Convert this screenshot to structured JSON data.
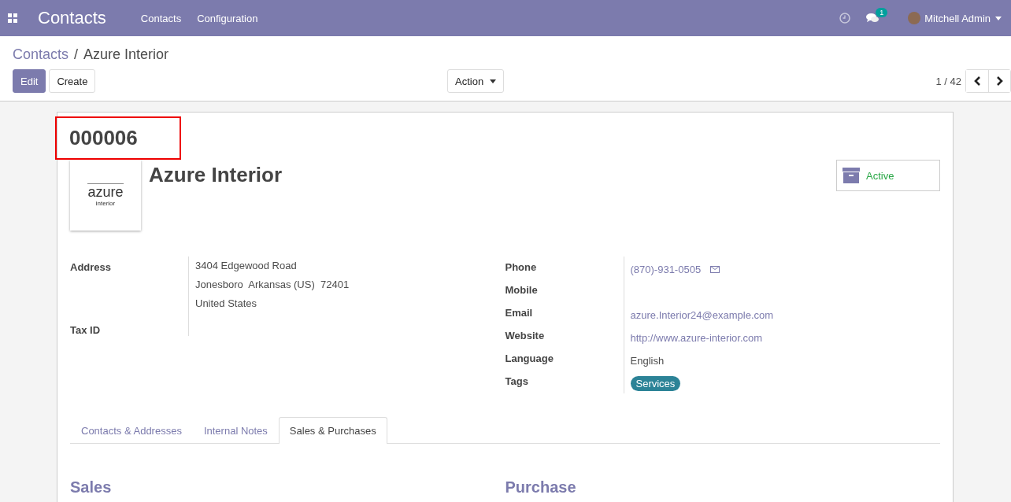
{
  "navbar": {
    "app_title": "Contacts",
    "menu": [
      "Contacts",
      "Configuration"
    ],
    "message_count": "1",
    "user": "Mitchell Admin"
  },
  "breadcrumb": {
    "parent": "Contacts",
    "separator": "/",
    "current": "Azure Interior"
  },
  "buttons": {
    "edit": "Edit",
    "create": "Create",
    "action": "Action"
  },
  "pager": "1 / 42",
  "record": {
    "reference": "000006",
    "name": "Azure Interior",
    "logo": {
      "top": "azure",
      "bottom": "interior"
    },
    "status": "Active"
  },
  "left_fields": [
    {
      "label": "Address",
      "lines": [
        "3404 Edgewood Road",
        "Jonesboro  Arkansas (US)  72401",
        "United States"
      ]
    },
    {
      "label": "Tax ID"
    }
  ],
  "right_fields": [
    {
      "label": "Phone",
      "value": "(870)-931-0505",
      "kind": "phone"
    },
    {
      "label": "Mobile",
      "kind": "text"
    },
    {
      "label": "Email",
      "value": "azure.Interior24@example.com",
      "kind": "link"
    },
    {
      "label": "Website",
      "value": "http://www.azure-interior.com",
      "kind": "link"
    },
    {
      "label": "Language",
      "value": "English",
      "kind": "text"
    },
    {
      "label": "Tags",
      "value": "Services",
      "kind": "tag"
    }
  ],
  "tabs": [
    {
      "label": "Contacts & Addresses",
      "selected": false
    },
    {
      "label": "Internal Notes",
      "selected": false
    },
    {
      "label": "Sales & Purchases",
      "selected": true
    }
  ],
  "sections": [
    "Sales",
    "Purchase"
  ]
}
